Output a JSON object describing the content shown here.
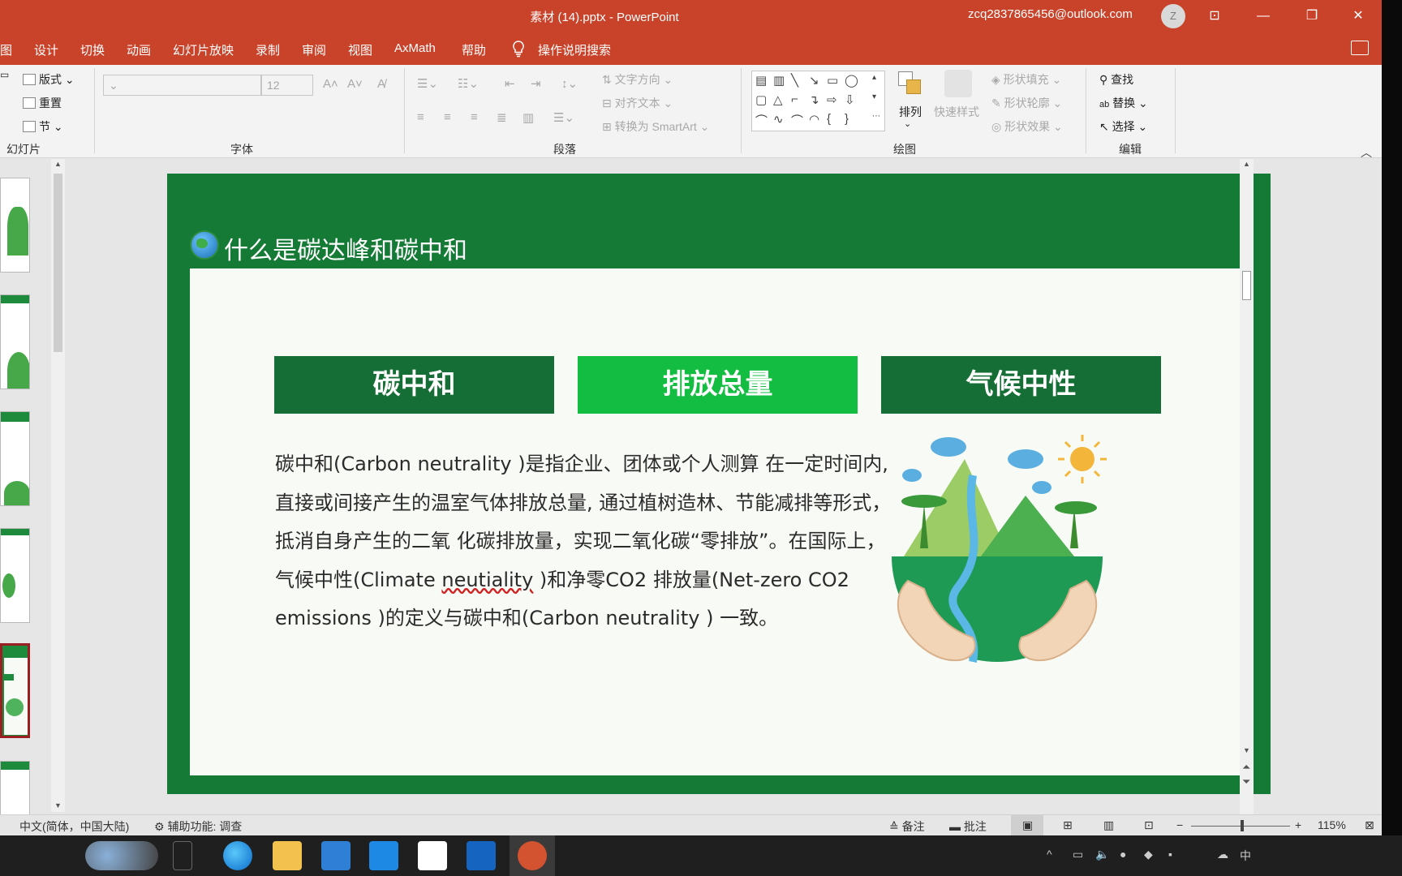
{
  "window": {
    "title": "素材 (14).pptx  -  PowerPoint",
    "account": "zcq2837865456@outlook.com",
    "avatar_letter": "Z"
  },
  "tabs": [
    "图",
    "设计",
    "切换",
    "动画",
    "幻灯片放映",
    "录制",
    "审阅",
    "视图",
    "AxMath",
    "帮助"
  ],
  "tell_me": "操作说明搜索",
  "ribbon": {
    "slides_group": {
      "label": "幻灯片",
      "layout": "版式",
      "reset": "重置",
      "section": "节"
    },
    "font_group": {
      "label": "字体",
      "font_size": "12"
    },
    "paragraph_group": {
      "label": "段落",
      "text_direction": "文字方向",
      "align_text": "对齐文本",
      "smartart": "转换为 SmartArt"
    },
    "drawing_group": {
      "label": "绘图",
      "arrange": "排列",
      "quick_styles": "快速样式",
      "shape_fill": "形状填充",
      "shape_outline": "形状轮廓",
      "shape_effects": "形状效果"
    },
    "editing_group": {
      "label": "编辑",
      "find": "查找",
      "replace": "替换",
      "select": "选择"
    }
  },
  "slide": {
    "title": "什么是碳达峰和碳中和",
    "keywords": [
      "碳中和",
      "排放总量",
      "气候中性"
    ],
    "body_parts": [
      "碳中和(Carbon neutrality )是指企业、团体或个人测算 在一定时间内,直接或间接产生的温室气体排放总量, 通过植树造林、节能减排等形式，抵消自身产生的二氧 化碳排放量，实现二氧化碳“零排放”。在国际上，气候中性(Climate ",
      "neutiality",
      " )和净零CO2 排放量(Net-zero CO2 emissions )的定义与碳中和(Carbon neutrality ) 一致。"
    ]
  },
  "status": {
    "language": "中文(简体，中国大陆)",
    "accessibility": "辅助功能: 调查",
    "notes": "备注",
    "comments": "批注",
    "zoom": "115%"
  },
  "colors": {
    "titlebar": "#c8432a",
    "slide_green": "#147a36",
    "kw_dark": "#156e35",
    "kw_light": "#12bd41"
  }
}
